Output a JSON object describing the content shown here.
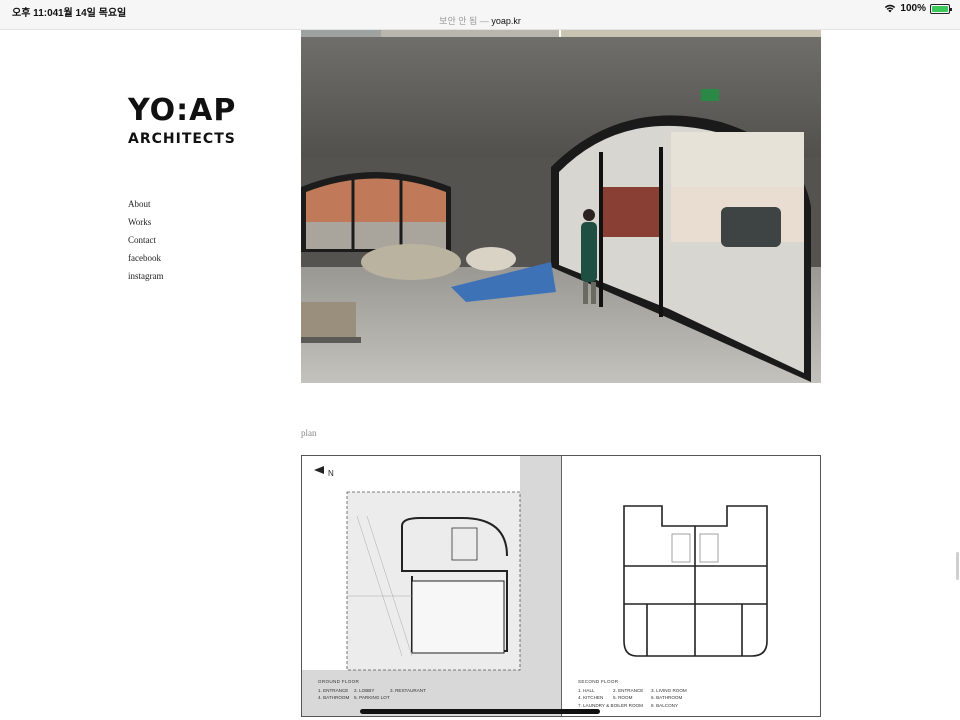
{
  "status_bar": {
    "time": "오후 11:04",
    "date": "1월 14일 목요일",
    "secure_label": "보안 안 됨 —",
    "domain": "yoap.kr",
    "battery_percent": "100%",
    "battery_level": 1.0
  },
  "logo": {
    "line1": "YO:AP",
    "line2": "ARCHITECTS"
  },
  "nav": {
    "items": [
      "About",
      "Works",
      "Contact",
      "facebook",
      "instagram"
    ]
  },
  "caption": "plan",
  "plan": {
    "ground": {
      "heading": "GROUND FLOOR",
      "items": [
        "1. ENTRANCE",
        "2. LOBBY",
        "3. RESTAURANT",
        "4. BATHROOM",
        "5. PARKING LOT"
      ]
    },
    "second": {
      "heading": "SECOND FLOOR",
      "items": [
        "1. HALL",
        "2. ENTRANCE",
        "3. LIVING ROOM",
        "4. KITCHEN",
        "5. ROOM",
        "6. BATHROOM",
        "7. LAUNDRY & BOILER ROOM",
        "8. BALCONY"
      ]
    }
  },
  "colors": {
    "accent_battery": "#3cc85a",
    "text": "#222222",
    "caption": "#888888"
  }
}
